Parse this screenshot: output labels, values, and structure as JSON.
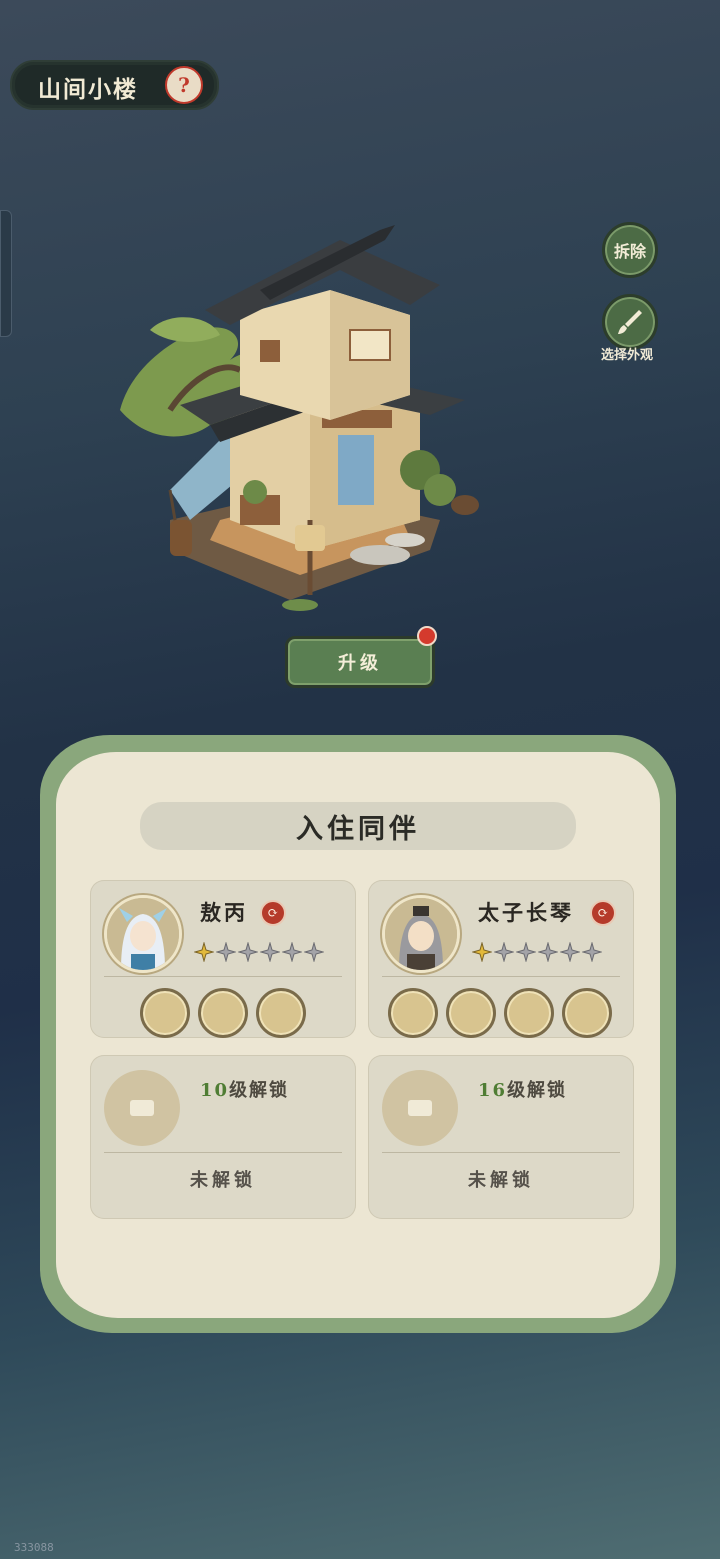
{
  "header": {
    "title": "山间小楼",
    "help_icon": "question-icon"
  },
  "side_buttons": {
    "demolish_label": "拆除",
    "appearance_label": "选择外观",
    "appearance_icon": "brush-icon"
  },
  "upgrade": {
    "label": "升级"
  },
  "panel": {
    "title": "入住同伴",
    "companions": [
      {
        "name": "敖丙",
        "stars_filled": 1,
        "stars_total": 6,
        "swap_icon": "swap-icon",
        "skills_count": 3
      },
      {
        "name": "太子长琴",
        "stars_filled": 1,
        "stars_total": 6,
        "swap_icon": "swap-icon",
        "skills_count": 4
      }
    ],
    "locked_slots": [
      {
        "level": "10",
        "unlock_suffix": "级解锁",
        "status": "未解锁"
      },
      {
        "level": "16",
        "unlock_suffix": "级解锁",
        "status": "未解锁"
      }
    ]
  },
  "footer": {
    "code": "333088"
  },
  "colors": {
    "accent_green": "#5a7f52",
    "badge_red": "#d43a2d",
    "level_green": "#4f7d34"
  }
}
